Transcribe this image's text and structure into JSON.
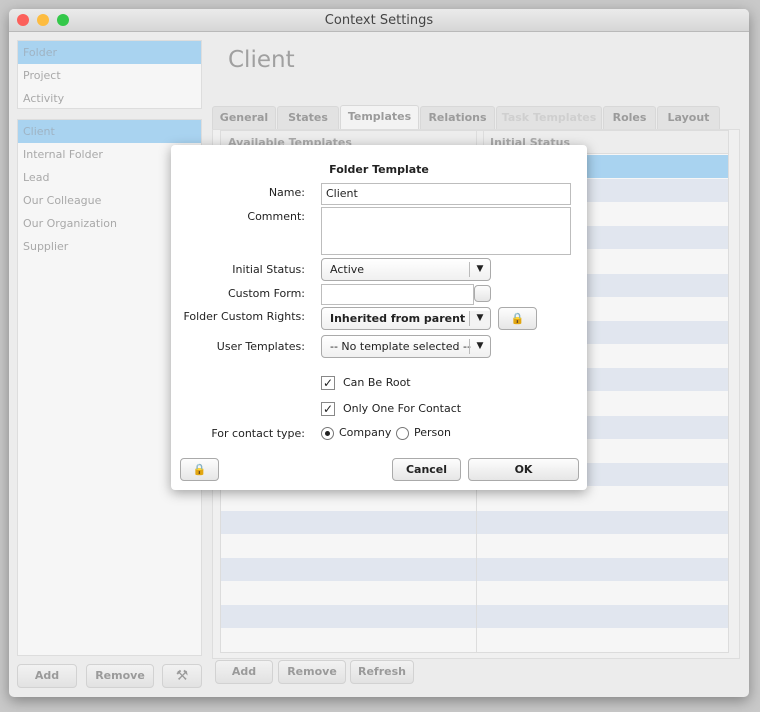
{
  "window": {
    "title": "Context Settings"
  },
  "sidebar": {
    "categories": [
      {
        "label": "Folder",
        "selected": true
      },
      {
        "label": "Project"
      },
      {
        "label": "Activity"
      }
    ],
    "items": [
      {
        "label": "Client",
        "selected": true
      },
      {
        "label": "Internal Folder"
      },
      {
        "label": "Lead"
      },
      {
        "label": "Our Colleague"
      },
      {
        "label": "Our Organization"
      },
      {
        "label": "Supplier"
      }
    ],
    "add_label": "Add",
    "remove_label": "Remove",
    "tools_icon": "wrench-icon"
  },
  "main": {
    "title": "Client",
    "tabs": [
      {
        "label": "General"
      },
      {
        "label": "States"
      },
      {
        "label": "Templates",
        "active": true
      },
      {
        "label": "Relations"
      },
      {
        "label": "Task Templates",
        "disabled": true
      },
      {
        "label": "Roles"
      },
      {
        "label": "Layout"
      }
    ],
    "table": {
      "columns": [
        "Available Templates",
        "Initial Status"
      ]
    },
    "add_label": "Add",
    "remove_label": "Remove",
    "refresh_label": "Refresh"
  },
  "dialog": {
    "title": "Folder Template",
    "name_label": "Name:",
    "name_value": "Client",
    "comment_label": "Comment:",
    "comment_value": "",
    "initial_status_label": "Initial Status:",
    "initial_status_value": "Active",
    "custom_form_label": "Custom Form:",
    "custom_form_value": "",
    "rights_label": "Folder Custom Rights:",
    "rights_value": "Inherited from parent fol",
    "user_templates_label": "User Templates:",
    "user_templates_value": "-- No template selected --",
    "can_be_root": {
      "label": "Can Be Root",
      "checked": true
    },
    "only_one": {
      "label": "Only One For Contact",
      "checked": true
    },
    "contact_type_label": "For contact type:",
    "contact_types": [
      {
        "label": "Company",
        "selected": true
      },
      {
        "label": "Person",
        "selected": false
      }
    ],
    "lock_icon": "lock-icon",
    "cancel_label": "Cancel",
    "ok_label": "OK"
  },
  "colors": {
    "selection": "#a9d3f0",
    "close": "#fc605b",
    "minimize": "#fdbc40",
    "zoom": "#34c84a"
  }
}
